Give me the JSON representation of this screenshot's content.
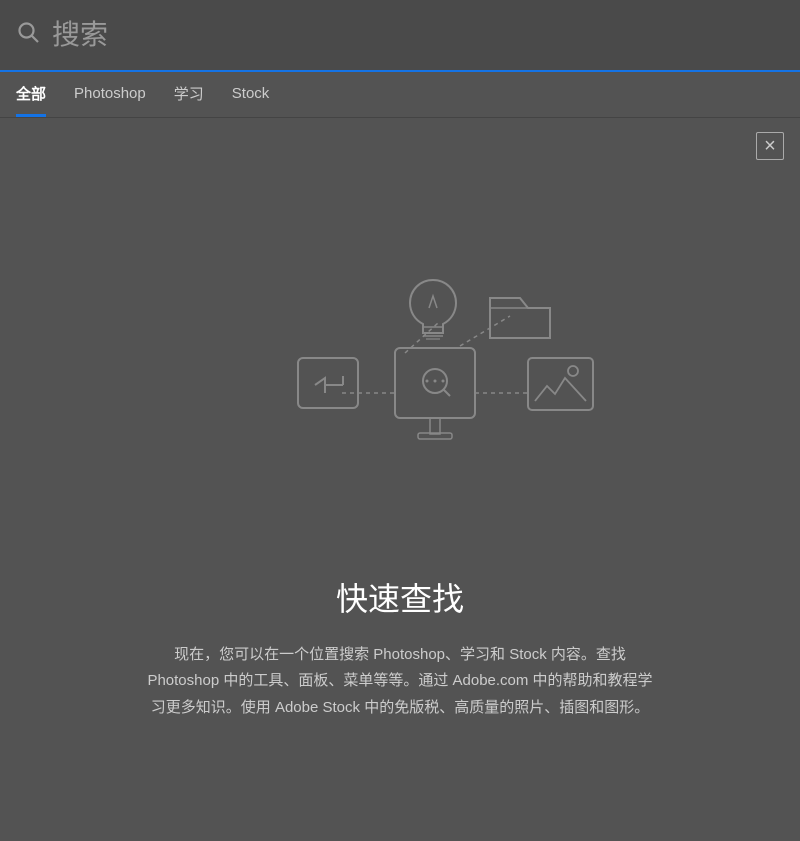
{
  "search": {
    "placeholder": "搜索",
    "search_icon": "🔍"
  },
  "tabs": [
    {
      "id": "all",
      "label": "全部",
      "active": true
    },
    {
      "id": "photoshop",
      "label": "Photoshop",
      "active": false
    },
    {
      "id": "learn",
      "label": "学习",
      "active": false
    },
    {
      "id": "stock",
      "label": "Stock",
      "active": false
    }
  ],
  "close_button": "×",
  "main": {
    "title": "快速查找",
    "description": "现在，您可以在一个位置搜索 Photoshop、学习和 Stock 内容。查找 Photoshop 中的工具、面板、菜单等等。通过 Adobe.com 中的帮助和教程学习更多知识。使用 Adobe Stock 中的免版税、高质量的照片、插图和图形。"
  }
}
